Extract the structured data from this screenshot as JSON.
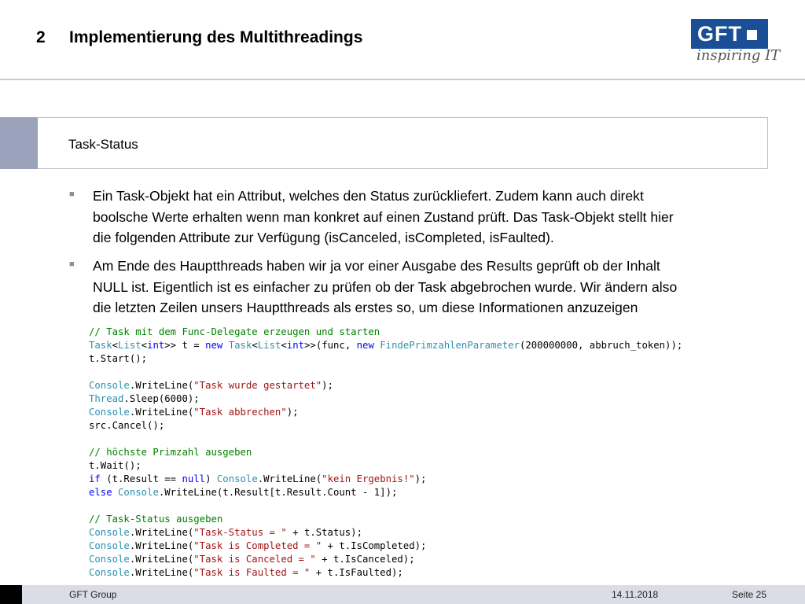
{
  "header": {
    "number": "2",
    "title": "Implementierung des Multithreadings"
  },
  "logo": {
    "brand": "GFT",
    "tagline": "inspiring IT",
    "brand_color": "#1a4e96"
  },
  "section": {
    "title": "Task-Status",
    "accent_color": "#9aa3bb"
  },
  "bullets": [
    {
      "lines": [
        "Ein Task-Objekt hat ein Attribut, welches den Status zurückliefert. Zudem kann auch direkt",
        "boolsche Werte erhalten wenn man konkret auf einen Zustand prüft. Das Task-Objekt stellt hier",
        "die folgenden Attribute zur Verfügung (isCanceled, isCompleted, isFaulted)."
      ]
    },
    {
      "lines": [
        "Am Ende des Hauptthreads haben wir ja vor einer Ausgabe des Results geprüft ob der Inhalt",
        "NULL ist. Eigentlich ist es einfacher zu prüfen ob der Task abgebrochen wurde. Wir ändern also",
        "die letzten Zeilen unsers Hauptthreads als erstes so, um diese Informationen anzuzeigen"
      ]
    }
  ],
  "code": {
    "lines": [
      [
        {
          "t": "cm",
          "v": "// Task mit dem Func-Delegate erzeugen und starten"
        }
      ],
      [
        {
          "t": "ty",
          "v": "Task"
        },
        {
          "t": "",
          "v": "<"
        },
        {
          "t": "ty",
          "v": "List"
        },
        {
          "t": "",
          "v": "<"
        },
        {
          "t": "kw",
          "v": "int"
        },
        {
          "t": "",
          "v": ">> t = "
        },
        {
          "t": "kw",
          "v": "new"
        },
        {
          "t": "",
          "v": " "
        },
        {
          "t": "ty",
          "v": "Task"
        },
        {
          "t": "",
          "v": "<"
        },
        {
          "t": "ty",
          "v": "List"
        },
        {
          "t": "",
          "v": "<"
        },
        {
          "t": "kw",
          "v": "int"
        },
        {
          "t": "",
          "v": ">>(func, "
        },
        {
          "t": "kw",
          "v": "new"
        },
        {
          "t": "",
          "v": " "
        },
        {
          "t": "ty",
          "v": "FindePrimzahlenParameter"
        },
        {
          "t": "",
          "v": "(200000000, abbruch_token));"
        }
      ],
      [
        {
          "t": "",
          "v": "t.Start();"
        }
      ],
      [
        {
          "t": "",
          "v": ""
        }
      ],
      [
        {
          "t": "ty",
          "v": "Console"
        },
        {
          "t": "",
          "v": ".WriteLine("
        },
        {
          "t": "st",
          "v": "\"Task wurde gestartet\""
        },
        {
          "t": "",
          "v": ");"
        }
      ],
      [
        {
          "t": "ty",
          "v": "Thread"
        },
        {
          "t": "",
          "v": ".Sleep(6000);"
        }
      ],
      [
        {
          "t": "ty",
          "v": "Console"
        },
        {
          "t": "",
          "v": ".WriteLine("
        },
        {
          "t": "st",
          "v": "\"Task abbrechen\""
        },
        {
          "t": "",
          "v": ");"
        }
      ],
      [
        {
          "t": "",
          "v": "src.Cancel();"
        }
      ],
      [
        {
          "t": "",
          "v": ""
        }
      ],
      [
        {
          "t": "cm",
          "v": "// höchste Primzahl ausgeben"
        }
      ],
      [
        {
          "t": "",
          "v": "t.Wait();"
        }
      ],
      [
        {
          "t": "kw",
          "v": "if"
        },
        {
          "t": "",
          "v": " (t.Result == "
        },
        {
          "t": "kw",
          "v": "null"
        },
        {
          "t": "",
          "v": ") "
        },
        {
          "t": "ty",
          "v": "Console"
        },
        {
          "t": "",
          "v": ".WriteLine("
        },
        {
          "t": "st",
          "v": "\"kein Ergebnis!\""
        },
        {
          "t": "",
          "v": ");"
        }
      ],
      [
        {
          "t": "kw",
          "v": "else"
        },
        {
          "t": "",
          "v": " "
        },
        {
          "t": "ty",
          "v": "Console"
        },
        {
          "t": "",
          "v": ".WriteLine(t.Result[t.Result.Count - 1]);"
        }
      ],
      [
        {
          "t": "",
          "v": ""
        }
      ],
      [
        {
          "t": "cm",
          "v": "// Task-Status ausgeben"
        }
      ],
      [
        {
          "t": "ty",
          "v": "Console"
        },
        {
          "t": "",
          "v": ".WriteLine("
        },
        {
          "t": "st",
          "v": "\"Task-Status = \""
        },
        {
          "t": "",
          "v": " + t.Status);"
        }
      ],
      [
        {
          "t": "ty",
          "v": "Console"
        },
        {
          "t": "",
          "v": ".WriteLine("
        },
        {
          "t": "st",
          "v": "\"Task is Completed = \""
        },
        {
          "t": "",
          "v": " + t.IsCompleted);"
        }
      ],
      [
        {
          "t": "ty",
          "v": "Console"
        },
        {
          "t": "",
          "v": ".WriteLine("
        },
        {
          "t": "st",
          "v": "\"Task is Canceled = \""
        },
        {
          "t": "",
          "v": " + t.IsCanceled);"
        }
      ],
      [
        {
          "t": "ty",
          "v": "Console"
        },
        {
          "t": "",
          "v": ".WriteLine("
        },
        {
          "t": "st",
          "v": "\"Task is Faulted = \""
        },
        {
          "t": "",
          "v": " + t.IsFaulted);"
        }
      ]
    ]
  },
  "footer": {
    "company": "GFT Group",
    "date": "14.11.2018",
    "page": "Seite 25"
  }
}
